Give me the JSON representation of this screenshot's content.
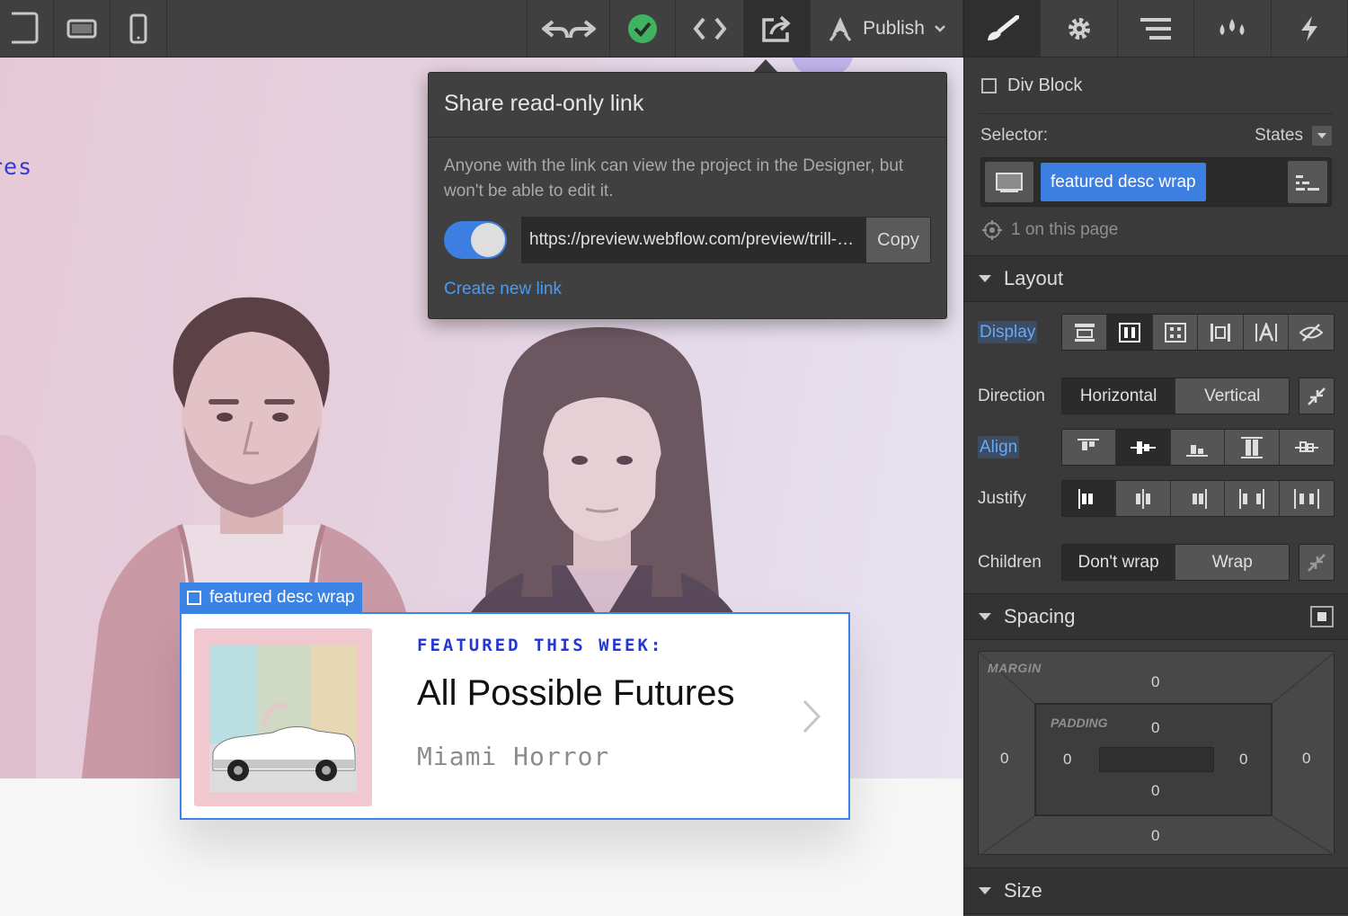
{
  "toolbar": {
    "publish_label": "Publish"
  },
  "canvas": {
    "nav_text": "res"
  },
  "share": {
    "title": "Share read-only link",
    "description": "Anyone with the link can view the project in the Designer, but won't be able to edit it.",
    "url": "https://preview.webflow.com/preview/trill-…",
    "copy_label": "Copy",
    "create_link_label": "Create new link",
    "toggle_on": true
  },
  "card": {
    "selection_tag": "featured desc wrap",
    "featured_label": "FEATURED THIS WEEK:",
    "album_title": "All Possible Futures",
    "artist": "Miami Horror"
  },
  "panel": {
    "element_type": "Div Block",
    "selector_label": "Selector:",
    "states_label": "States",
    "selector_chip": "featured desc wrap",
    "on_page": "1 on this page",
    "layout": {
      "title": "Layout",
      "display_label": "Display",
      "direction_label": "Direction",
      "direction_options": [
        "Horizontal",
        "Vertical"
      ],
      "direction_selected": "Horizontal",
      "align_label": "Align",
      "justify_label": "Justify",
      "children_label": "Children",
      "children_options": [
        "Don't wrap",
        "Wrap"
      ],
      "children_selected": "Don't wrap"
    },
    "spacing": {
      "title": "Spacing",
      "margin_label": "MARGIN",
      "padding_label": "PADDING",
      "margin": {
        "top": "0",
        "right": "0",
        "bottom": "0",
        "left": "0"
      },
      "padding": {
        "top": "0",
        "right": "0",
        "bottom": "0",
        "left": "0"
      }
    },
    "size": {
      "title": "Size"
    }
  },
  "colors": {
    "accent": "#3d7fe0",
    "publish_check": "#3fb35f",
    "featured_blue": "#2336d6"
  }
}
